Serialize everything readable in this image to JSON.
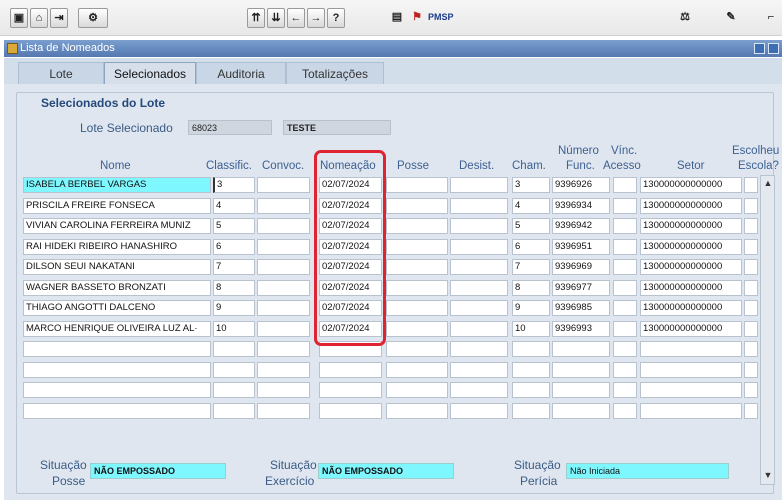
{
  "window": {
    "title": "Lista de Nomeados"
  },
  "toolbar": {
    "pmsp_label": "PMSP"
  },
  "tabs": [
    {
      "label": "Lote"
    },
    {
      "label": "Selecionados"
    },
    {
      "label": "Auditoria"
    },
    {
      "label": "Totalizações"
    }
  ],
  "section": {
    "title": "Selecionados do Lote"
  },
  "lote": {
    "label": "Lote Selecionado",
    "number": "68023",
    "name": "TESTE"
  },
  "columns": {
    "nome": "Nome",
    "classific": "Classific.",
    "convoc": "Convoc.",
    "nomeacao": "Nomeação",
    "posse": "Posse",
    "desist": "Desist.",
    "cham": "Cham.",
    "numero_l1": "Número",
    "numero_l2": "Func.",
    "vinc_l1": "Vínc.",
    "vinc_l2": "Acesso",
    "setor": "Setor",
    "escolheu_l1": "Escolheu",
    "escolheu_l2": "Escola?"
  },
  "rows": [
    {
      "nome": "ISABELA BERBEL VARGAS",
      "classific": "3",
      "convoc": "",
      "nomeacao": "02/07/2024",
      "posse": "",
      "desist": "",
      "cham": "3",
      "func": "9396926",
      "vinc": "",
      "setor": "130000000000000",
      "escolheu": ""
    },
    {
      "nome": "PRISCILA FREIRE FONSECA",
      "classific": "4",
      "convoc": "",
      "nomeacao": "02/07/2024",
      "posse": "",
      "desist": "",
      "cham": "4",
      "func": "9396934",
      "vinc": "",
      "setor": "130000000000000",
      "escolheu": ""
    },
    {
      "nome": "VIVIAN CAROLINA FERREIRA MUNIZ",
      "classific": "5",
      "convoc": "",
      "nomeacao": "02/07/2024",
      "posse": "",
      "desist": "",
      "cham": "5",
      "func": "9396942",
      "vinc": "",
      "setor": "130000000000000",
      "escolheu": ""
    },
    {
      "nome": "RAI HIDEKI RIBEIRO HANASHIRO",
      "classific": "6",
      "convoc": "",
      "nomeacao": "02/07/2024",
      "posse": "",
      "desist": "",
      "cham": "6",
      "func": "9396951",
      "vinc": "",
      "setor": "130000000000000",
      "escolheu": ""
    },
    {
      "nome": "DILSON SEUI NAKATANI",
      "classific": "7",
      "convoc": "",
      "nomeacao": "02/07/2024",
      "posse": "",
      "desist": "",
      "cham": "7",
      "func": "9396969",
      "vinc": "",
      "setor": "130000000000000",
      "escolheu": ""
    },
    {
      "nome": "WAGNER BASSETO BRONZATI",
      "classific": "8",
      "convoc": "",
      "nomeacao": "02/07/2024",
      "posse": "",
      "desist": "",
      "cham": "8",
      "func": "9396977",
      "vinc": "",
      "setor": "130000000000000",
      "escolheu": ""
    },
    {
      "nome": "THIAGO ANGOTTI DALCENO",
      "classific": "9",
      "convoc": "",
      "nomeacao": "02/07/2024",
      "posse": "",
      "desist": "",
      "cham": "9",
      "func": "9396985",
      "vinc": "",
      "setor": "130000000000000",
      "escolheu": ""
    },
    {
      "nome": "MARCO HENRIQUE OLIVEIRA LUZ AL·",
      "classific": "10",
      "convoc": "",
      "nomeacao": "02/07/2024",
      "posse": "",
      "desist": "",
      "cham": "10",
      "func": "9396993",
      "vinc": "",
      "setor": "130000000000000",
      "escolheu": ""
    },
    {
      "nome": "",
      "classific": "",
      "convoc": "",
      "nomeacao": "",
      "posse": "",
      "desist": "",
      "cham": "",
      "func": "",
      "vinc": "",
      "setor": "",
      "escolheu": ""
    },
    {
      "nome": "",
      "classific": "",
      "convoc": "",
      "nomeacao": "",
      "posse": "",
      "desist": "",
      "cham": "",
      "func": "",
      "vinc": "",
      "setor": "",
      "escolheu": ""
    },
    {
      "nome": "",
      "classific": "",
      "convoc": "",
      "nomeacao": "",
      "posse": "",
      "desist": "",
      "cham": "",
      "func": "",
      "vinc": "",
      "setor": "",
      "escolheu": ""
    },
    {
      "nome": "",
      "classific": "",
      "convoc": "",
      "nomeacao": "",
      "posse": "",
      "desist": "",
      "cham": "",
      "func": "",
      "vinc": "",
      "setor": "",
      "escolheu": ""
    }
  ],
  "status": {
    "posse_label_l1": "Situação",
    "posse_label_l2": "Posse",
    "posse_value": "NÃO EMPOSSADO",
    "exercicio_label_l1": "Situação",
    "exercicio_label_l2": "Exercício",
    "exercicio_value": "NÃO EMPOSSADO",
    "pericia_label_l1": "Situação",
    "pericia_label_l2": "Perícia",
    "pericia_value": "Não Iniciada"
  },
  "colors": {
    "selected_row": "#7ff7ff",
    "highlight": "#e02331",
    "titlebar": "#5478b0"
  }
}
